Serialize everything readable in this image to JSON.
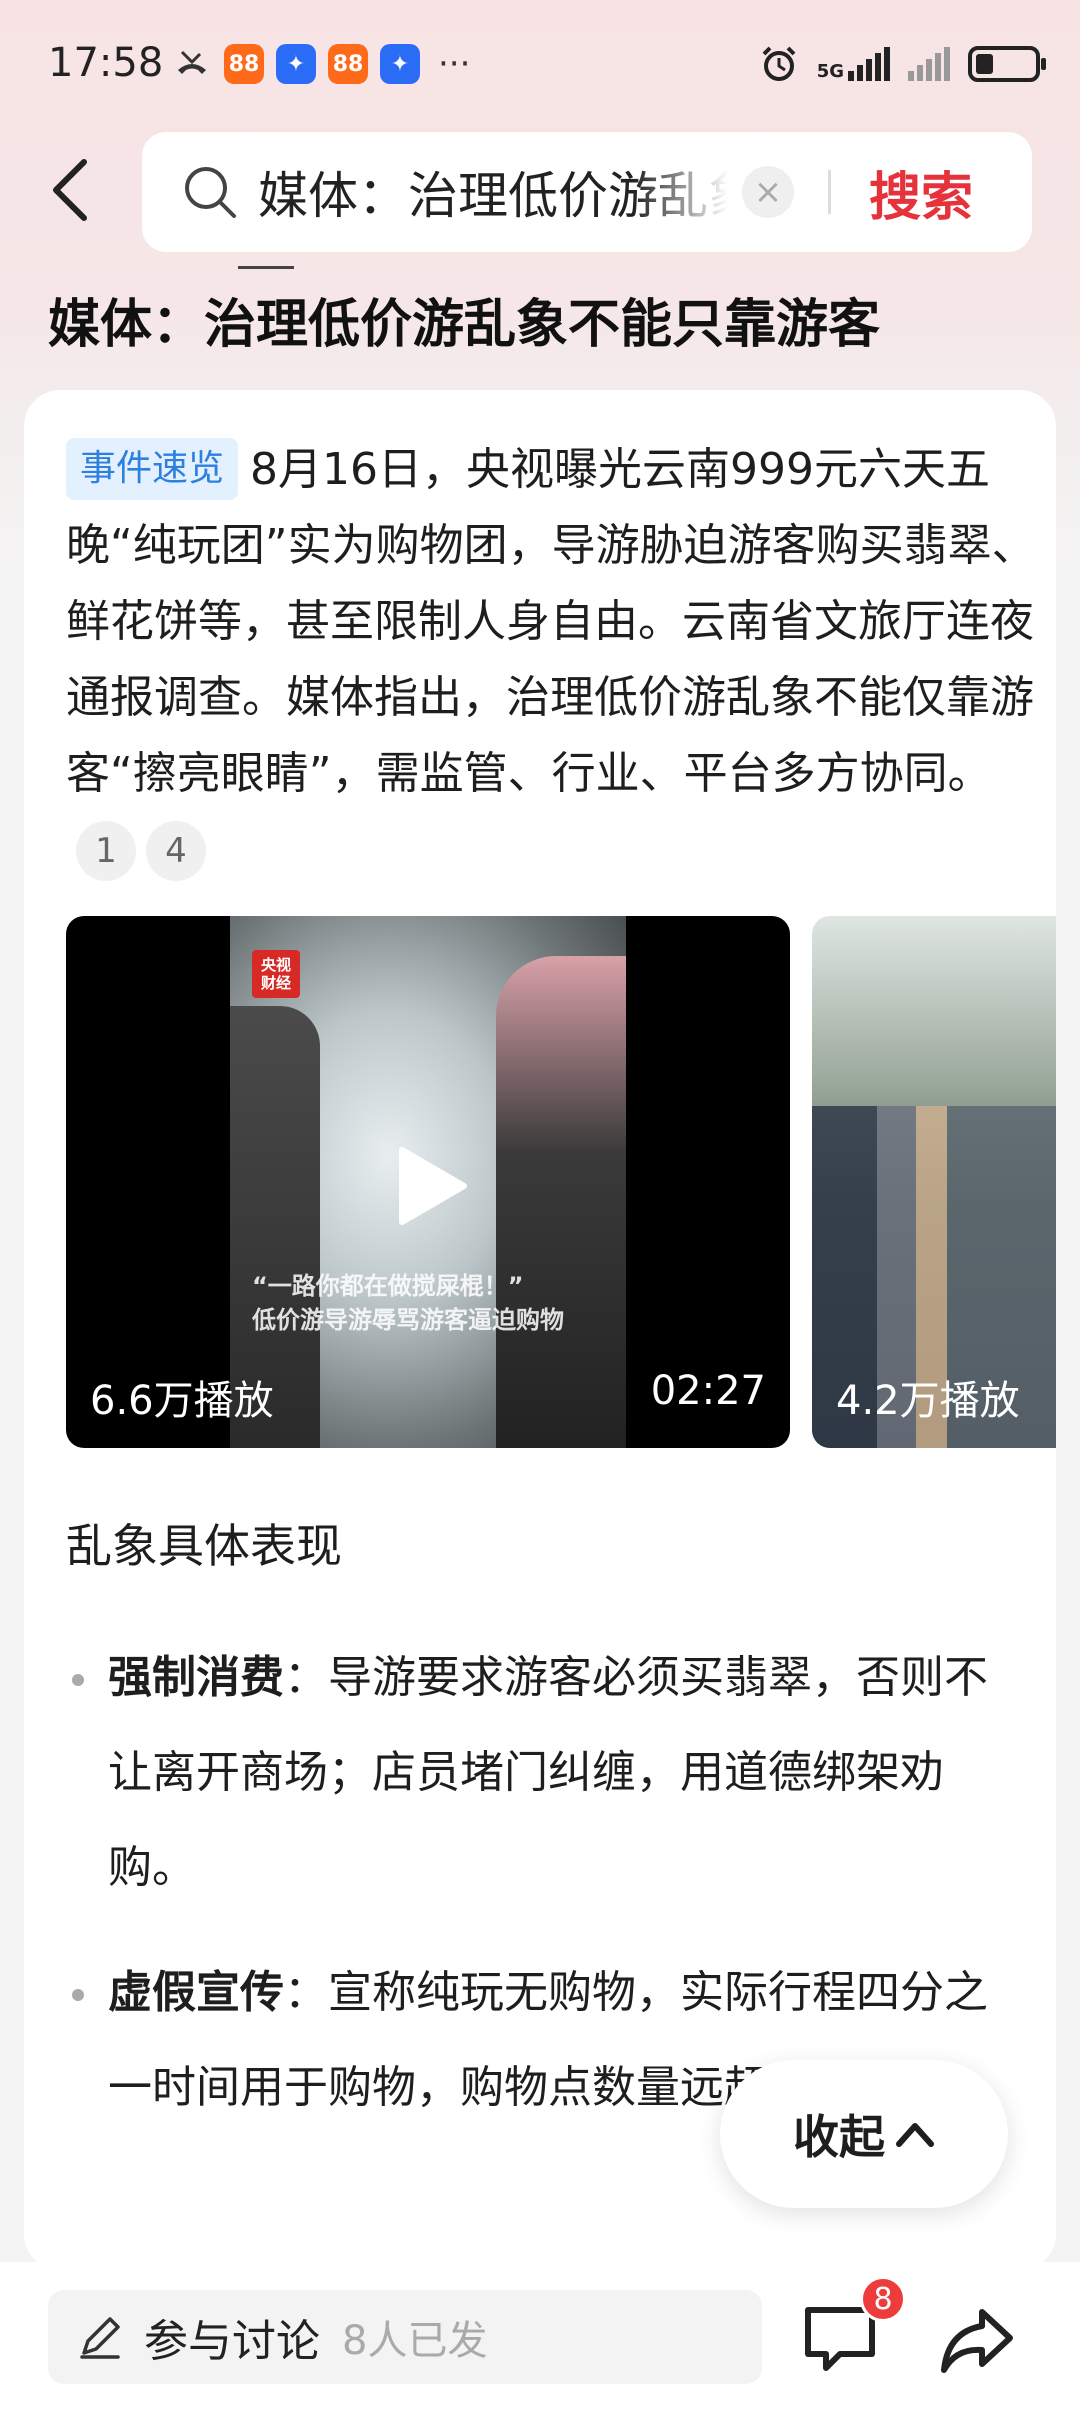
{
  "status_bar": {
    "time": "17:58",
    "app_icons": [
      "notification-app-orange",
      "notification-app-blue",
      "notification-app-orange",
      "notification-app-blue"
    ],
    "more": "···",
    "network": "5G",
    "battery_level": 0.3
  },
  "search": {
    "query": "媒体：治理低价游乱象不能只靠游客",
    "button_label": "搜索"
  },
  "page": {
    "title": "媒体：治理低价游乱象不能只靠游客"
  },
  "summary": {
    "tag": "事件速览",
    "text": "8月16日，央视曝光云南999元六天五晚“纯玩团”实为购物团，导游胁迫游客购买翡翠、鲜花饼等，甚至限制人身自由。云南省文旅厅连夜通报调查。媒体指出，治理低价游乱象不能仅靠游客“擦亮眼睛”，需监管、行业、平台多方协同。",
    "refs": [
      "1",
      "4"
    ]
  },
  "videos": [
    {
      "views": "6.6万播放",
      "duration": "02:27",
      "logo": "央视\n财经",
      "subtitle_line1": "“一路你都在做搅屎棍！”",
      "subtitle_line2": "低价游导游辱骂游客逼迫购物"
    },
    {
      "views": "4.2万播放"
    }
  ],
  "section": {
    "heading": "乱象具体表现",
    "bullets": [
      {
        "title": "强制消费",
        "sep": "：",
        "text": "导游要求游客必须买翡翠，否则不让离开商场；店员堵门纠缠，用道德绑架劝购。"
      },
      {
        "title": "虚假宣传",
        "sep": "：",
        "text": "宣称纯玩无购物，实际行程四分之一时间用于购物，购物点数量远超承诺。"
      }
    ]
  },
  "collapse": {
    "label": "收起"
  },
  "bottom_bar": {
    "discuss_label": "参与讨论",
    "discuss_count": "8人已发",
    "comment_badge": "8"
  }
}
